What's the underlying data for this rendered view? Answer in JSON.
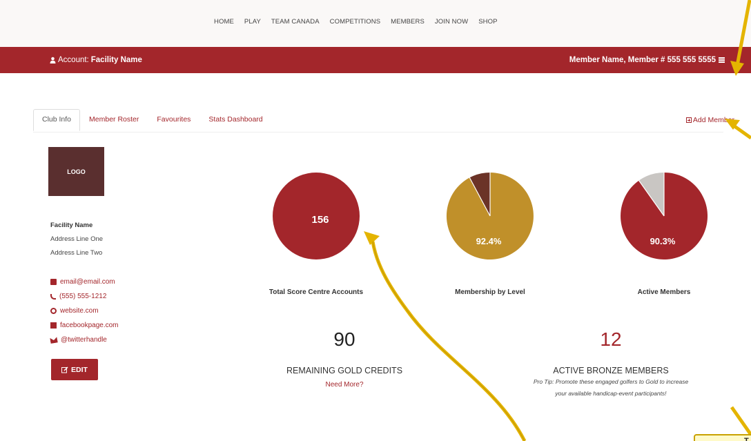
{
  "nav": {
    "items": [
      "HOME",
      "PLAY",
      "TEAM CANADA",
      "COMPETITIONS",
      "MEMBERS",
      "JOIN NOW",
      "SHOP"
    ]
  },
  "header": {
    "account_prefix": "Account:",
    "account_name": "Facility Name",
    "member_info": "Member Name, Member # 555 555 5555"
  },
  "tabs": [
    "Club Info",
    "Member Roster",
    "Favourites",
    "Stats Dashboard"
  ],
  "add_member": "Add Member",
  "logo_text": "LOGO",
  "facility": {
    "name": "Facility Name",
    "address1": "Address Line One",
    "address2": "Address Line Two"
  },
  "contacts": {
    "email": "email@email.com",
    "phone": "(555) 555-1212",
    "website": "website.com",
    "facebook": "facebookpage.com",
    "twitter": "@twitterhandle"
  },
  "edit_label": "EDIT",
  "charts": {
    "total": {
      "value": "156",
      "label": "Total Score Centre Accounts"
    },
    "membership": {
      "value": "92.4%",
      "label": "Membership by Level"
    },
    "active": {
      "value": "90.3%",
      "label": "Active Members"
    }
  },
  "stats": {
    "gold_count": "90",
    "gold_label": "REMAINING GOLD CREDITS",
    "need_more": "Need More?",
    "bronze_count": "12",
    "bronze_label": "ACTIVE BRONZE MEMBERS",
    "pro_tip_line1": "Pro Tip: Promote these engaged golfers to Gold to increase",
    "pro_tip_line2": "your available handicap-event participants!"
  },
  "callout_letter": "T",
  "colors": {
    "brand_red": "#a3262b",
    "gold": "#c0902a",
    "brown": "#6b3327",
    "grey": "#c9c6c3",
    "arrow": "#e4b400"
  },
  "chart_data": [
    {
      "type": "pie",
      "title": "",
      "label": "Total Score Centre Accounts",
      "slices": [
        {
          "value": 156
        }
      ]
    },
    {
      "type": "pie",
      "label": "Membership by Level",
      "slices": [
        {
          "value": 92.4,
          "color": "#c0902a"
        },
        {
          "value": 7.6,
          "color": "#6b3327"
        }
      ]
    },
    {
      "type": "pie",
      "label": "Active Members",
      "slices": [
        {
          "value": 90.3,
          "color": "#a3262b"
        },
        {
          "value": 9.7,
          "color": "#c9c6c3"
        }
      ]
    }
  ]
}
